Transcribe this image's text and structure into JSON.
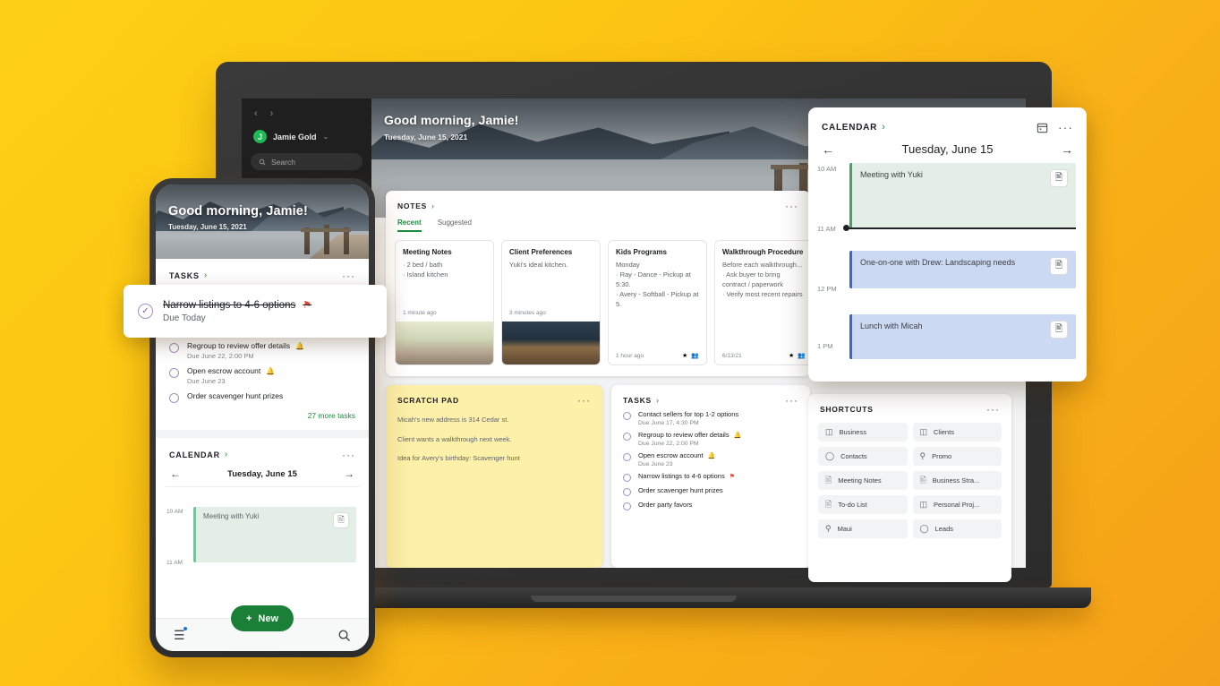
{
  "background": {
    "color_top": "#FDD015",
    "color_bottom": "#F5A118"
  },
  "sidebar": {
    "back_icon": "‹",
    "forward_icon": "›",
    "avatar_initial": "J",
    "account_name": "Jamie Gold",
    "caret_icon": "⌄",
    "search_placeholder": "Search",
    "search_icon": "⌕"
  },
  "hero": {
    "greeting": "Good morning, Jamie!",
    "date": "Tuesday, June 15, 2021"
  },
  "notes": {
    "title": "NOTES",
    "chevron": "›",
    "menu_icon": "···",
    "tabs": [
      {
        "label": "Recent",
        "active": true
      },
      {
        "label": "Suggested",
        "active": false
      }
    ],
    "items": [
      {
        "heading": "Meeting Notes",
        "body": "· 2 bed / bath\n· Island kitchen",
        "time": "1 minute ago",
        "thumb": "living-room",
        "icons": []
      },
      {
        "heading": "Client Preferences",
        "body": "Yuki's ideal kitchen.",
        "time": "3 minutes ago",
        "thumb": "kitchen",
        "icons": []
      },
      {
        "heading": "Kids Programs",
        "body": "Monday\n· Ray - Dance - Pickup at 5:30.\n· Avery - Softball - Pickup at 5.",
        "time": "1 hour ago",
        "thumb": "none",
        "icons": [
          "★",
          "👥"
        ]
      },
      {
        "heading": "Walkthrough Procedure",
        "body": "Before each walkthrough...\n· Ask buyer to bring contract / paperwork\n· Verify most recent repairs",
        "time": "6/13/21",
        "thumb": "none",
        "icons": [
          "★",
          "👥"
        ]
      }
    ]
  },
  "scratch_pad": {
    "title": "SCRATCH PAD",
    "menu_icon": "···",
    "lines": [
      "Micah's new address is 314 Cedar st.",
      "Client wants a walkthrough next week.",
      "Idea for Avery's birthday: Scavenger hunt"
    ]
  },
  "tasks_panel": {
    "title": "TASKS",
    "chevron": "›",
    "menu_icon": "···",
    "items": [
      {
        "text": "Contact sellers for top 1-2 options",
        "due": "Due June 17, 4:30 PM",
        "bell": false,
        "flag": false
      },
      {
        "text": "Regroup to review offer details",
        "due": "Due June 22, 2:00 PM",
        "bell": true,
        "flag": false
      },
      {
        "text": "Open escrow account",
        "due": "Due June 23",
        "bell": true,
        "flag": false
      },
      {
        "text": "Narrow listings to 4-6 options",
        "due": "",
        "bell": false,
        "flag": true
      },
      {
        "text": "Order scavenger hunt prizes",
        "due": "",
        "bell": false,
        "flag": false
      },
      {
        "text": "Order party favors",
        "due": "",
        "bell": false,
        "flag": false
      }
    ],
    "bell_icon": "🔔",
    "flag_icon": "⚑"
  },
  "calendar": {
    "title": "CALENDAR",
    "chevron": "›",
    "calendar_icon": "▤",
    "menu_icon": "···",
    "prev_icon": "←",
    "next_icon": "→",
    "date": "Tuesday, June 15",
    "hours": [
      "10 AM",
      "11 AM",
      "12 PM",
      "1 PM"
    ],
    "now_time": "11 AM",
    "events": [
      {
        "title": "Meeting with Yuki",
        "color": "green",
        "note_icon": "📄"
      },
      {
        "title": "One-on-one with Drew: Landscaping needs",
        "color": "blue",
        "note_icon": "📄"
      },
      {
        "title": "Lunch with Micah",
        "color": "blue",
        "note_icon": "📄"
      }
    ]
  },
  "shortcuts": {
    "title": "SHORTCUTS",
    "menu_icon": "···",
    "items": [
      {
        "label": "Business",
        "icon": "doc"
      },
      {
        "label": "Clients",
        "icon": "doc"
      },
      {
        "label": "Contacts",
        "icon": "tag"
      },
      {
        "label": "Promo",
        "icon": "search"
      },
      {
        "label": "Meeting Notes",
        "icon": "note"
      },
      {
        "label": "Business Stra...",
        "icon": "note"
      },
      {
        "label": "To-do List",
        "icon": "note"
      },
      {
        "label": "Personal Proj...",
        "icon": "doc"
      },
      {
        "label": "Maui",
        "icon": "search"
      },
      {
        "label": "Leads",
        "icon": "tag"
      }
    ]
  },
  "phone": {
    "hero_greeting": "Good morning, Jamie!",
    "hero_date": "Tuesday, June 15, 2021",
    "tasks_title": "TASKS",
    "chevron": "›",
    "menu_icon": "···",
    "tasks": [
      {
        "text": "Regroup to review offer details",
        "due": "Due June 22, 2:00 PM",
        "bell": true
      },
      {
        "text": "Open escrow account",
        "due": "Due June 23",
        "bell": true
      },
      {
        "text": "Order scavenger hunt prizes",
        "due": "",
        "bell": false
      }
    ],
    "more_tasks": "27 more tasks",
    "calendar_title": "CALENDAR",
    "cal_prev": "←",
    "cal_next": "→",
    "cal_date": "Tuesday, June 15",
    "hours": [
      "10 AM",
      "11 AM"
    ],
    "event_title": "Meeting with Yuki",
    "event_note_icon": "📄",
    "fab_label": "New",
    "fab_plus": "+",
    "nav_list_icon": "☰",
    "nav_search_icon": "⌕"
  },
  "task_toast": {
    "check_icon": "✓",
    "text": "Narrow listings to 4-6 options",
    "flag_icon": "⚑",
    "due": "Due Today"
  }
}
